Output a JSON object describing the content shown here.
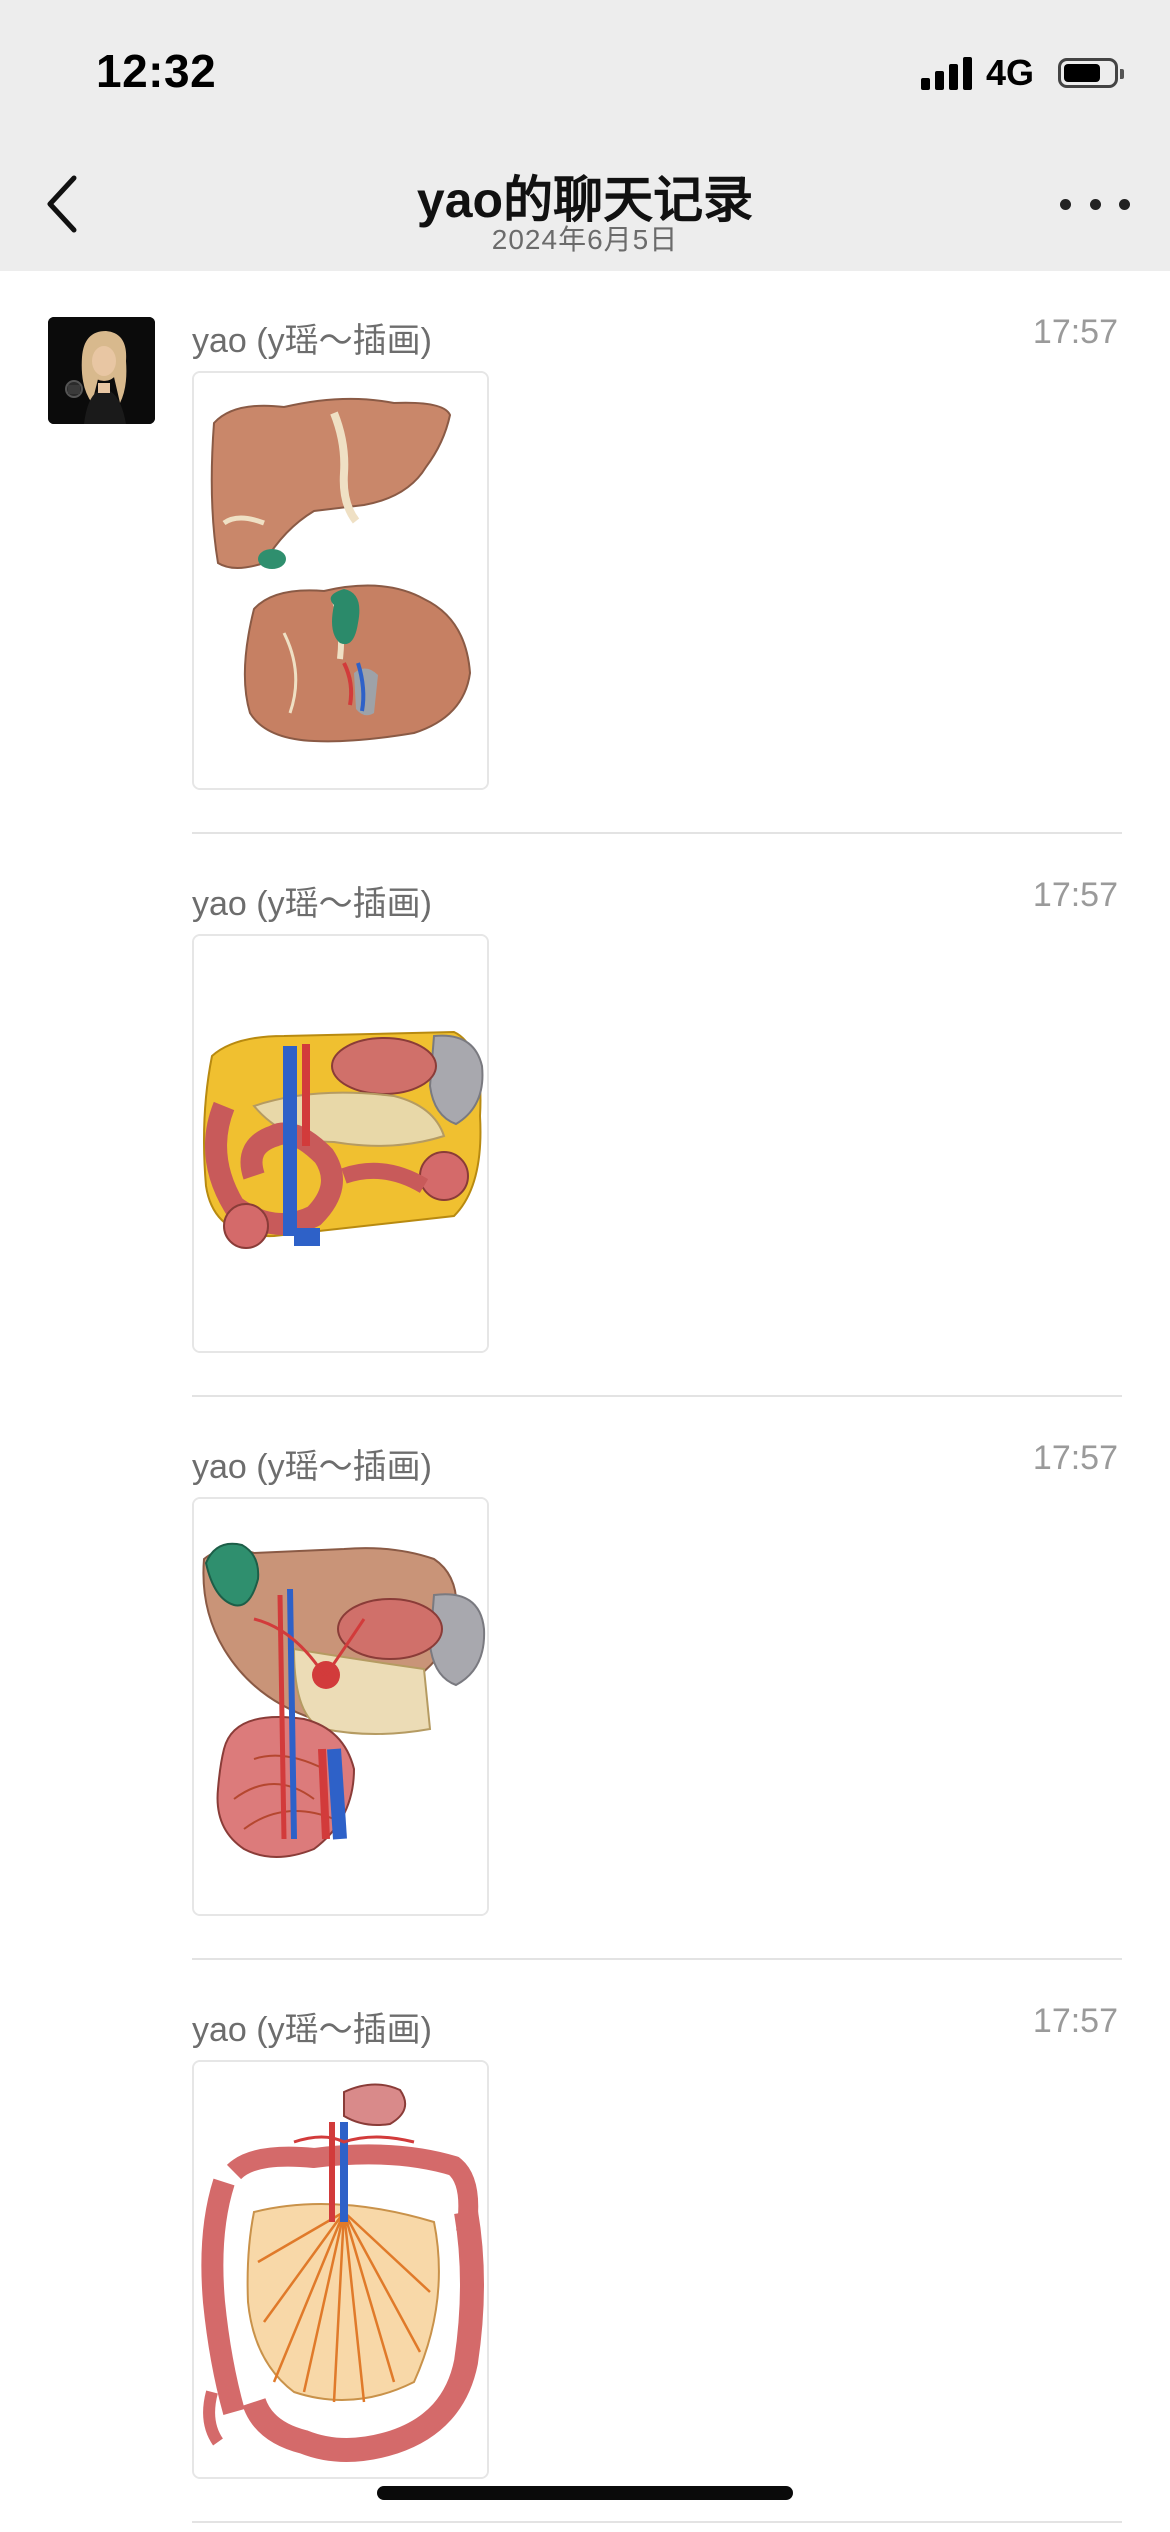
{
  "status_bar": {
    "time": "12:32",
    "network": "4G",
    "signal_icon": "signal-bars-icon",
    "battery_icon": "battery-icon",
    "battery_level": 0.75
  },
  "header": {
    "title": "yao的聊天记录",
    "subtitle": "2024年6月5日",
    "back_icon": "chevron-left-icon",
    "more_icon": "more-dots-icon"
  },
  "messages": [
    {
      "sender": "yao (y瑶～插画)",
      "time": "17:57",
      "image_subject": "liver-anatomy-illustration",
      "show_avatar": true
    },
    {
      "sender": "yao (y瑶～插画)",
      "time": "17:57",
      "image_subject": "pancreas-duodenum-illustration",
      "show_avatar": false
    },
    {
      "sender": "yao (y瑶～插画)",
      "time": "17:57",
      "image_subject": "stomach-vessels-illustration",
      "show_avatar": false
    },
    {
      "sender": "yao (y瑶～插画)",
      "time": "17:57",
      "image_subject": "intestine-mesentery-illustration",
      "show_avatar": false
    }
  ],
  "colors": {
    "header_bg": "#ededed",
    "sender_text": "#6d6d6d",
    "time_text": "#9a9a9a",
    "divider": "#e3e3e3"
  }
}
